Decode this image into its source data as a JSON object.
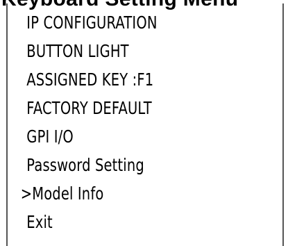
{
  "menu": {
    "title": "Keyboard Setting Menu",
    "items": [
      {
        "label": "IP CONFIGURATION"
      },
      {
        "label": "BUTTON LIGHT"
      },
      {
        "label": "ASSIGNED KEY :F1"
      },
      {
        "label": "FACTORY DEFAULT"
      },
      {
        "label": "GPI I/O"
      },
      {
        "label": "Password Setting"
      },
      {
        "label": ">Model Info"
      },
      {
        "label": "Exit"
      }
    ]
  }
}
